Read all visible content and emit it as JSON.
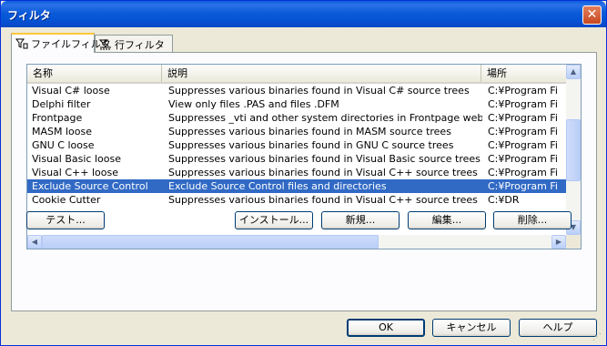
{
  "window": {
    "title": "フィルタ",
    "close_label": "✕"
  },
  "tabs": [
    {
      "label": "ファイルフィルタ",
      "icon": "filter-funnel-icon"
    },
    {
      "label": "行フィルタ",
      "icon": "line-filter-icon"
    }
  ],
  "list": {
    "columns": [
      "名称",
      "説明",
      "場所"
    ],
    "rows": [
      {
        "name": "Visual C# loose",
        "desc": "Suppresses various binaries found in Visual C# source trees",
        "loc": "C:¥Program Fi"
      },
      {
        "name": "Delphi filter",
        "desc": "View only files .PAS and files .DFM",
        "loc": "C:¥Program Fi"
      },
      {
        "name": "Frontpage",
        "desc": "Suppresses _vti and other system directories in Frontpage websi...",
        "loc": "C:¥Program Fi"
      },
      {
        "name": "MASM loose",
        "desc": "Suppresses various binaries found in MASM source trees",
        "loc": "C:¥Program Fi"
      },
      {
        "name": "GNU C loose",
        "desc": "Suppresses various binaries found in GNU C source trees",
        "loc": "C:¥Program Fi"
      },
      {
        "name": "Visual Basic loose",
        "desc": "Suppresses various binaries found in Visual Basic source trees",
        "loc": "C:¥Program Fi"
      },
      {
        "name": "Visual C++ loose",
        "desc": "Suppresses various binaries found in Visual C++ source trees",
        "loc": "C:¥Program Fi"
      },
      {
        "name": "Exclude Source Control",
        "desc": "Exclude Source Control files and directories",
        "loc": "C:¥Program Fi",
        "selected": true
      },
      {
        "name": "Cookie Cutter",
        "desc": "Suppresses various binaries found in Visual C++ source trees",
        "loc": "C:¥DR"
      }
    ]
  },
  "buttons": {
    "test": "テスト...",
    "install": "インストール...",
    "new": "新規...",
    "edit": "編集...",
    "delete": "削除...",
    "ok": "OK",
    "cancel": "キャンセル",
    "help": "ヘルプ"
  },
  "colors": {
    "selection": "#316ac5",
    "titlebar": "#0554d6",
    "face": "#ece9d8"
  }
}
